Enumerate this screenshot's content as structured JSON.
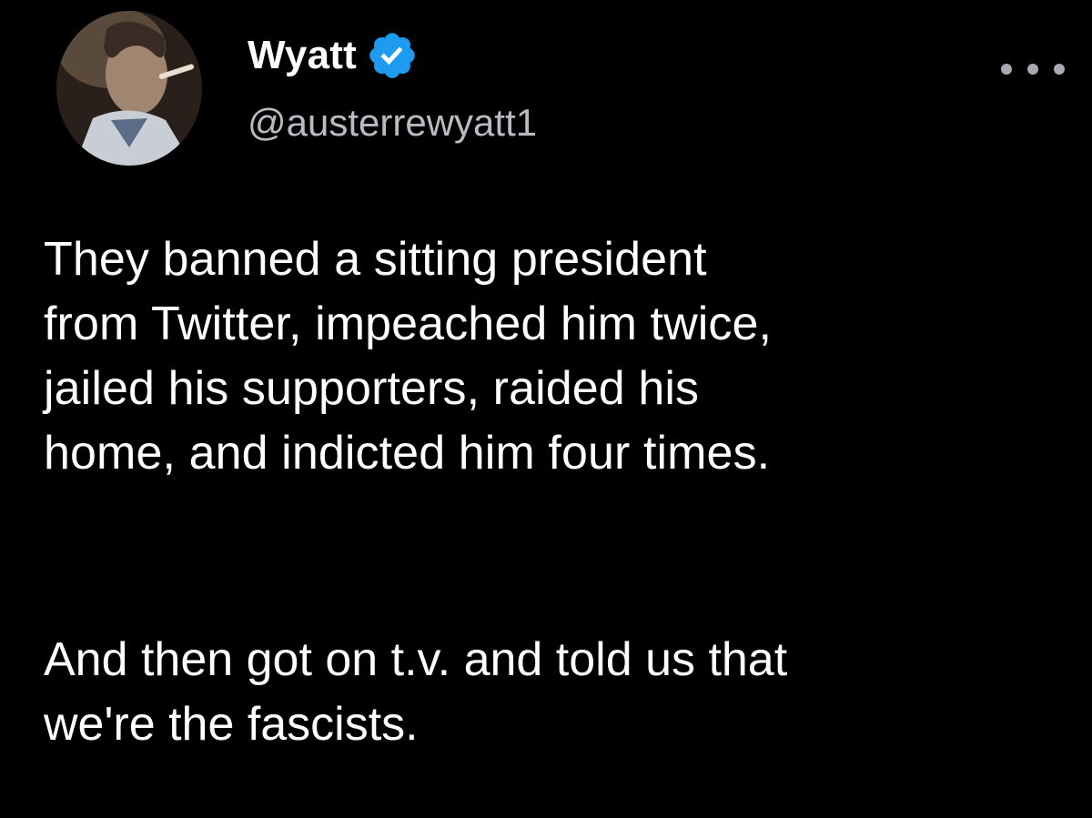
{
  "tweet": {
    "author": {
      "display_name": "Wyatt",
      "handle": "@austerrewyatt1",
      "verified": true,
      "verified_color": "#1d9bf0"
    },
    "menu_icon": "more-horizontal-icon",
    "text_lines_p1": [
      "They banned a sitting president",
      "from Twitter, impeached him twice,",
      "jailed his supporters, raided his",
      "home, and indicted him four times."
    ],
    "text_lines_p2": [
      "And then got on t.v. and told us that",
      "we're the fascists."
    ]
  },
  "colors": {
    "background": "#000000",
    "text": "#ffffff",
    "secondary_text": "#b8bcc2"
  }
}
